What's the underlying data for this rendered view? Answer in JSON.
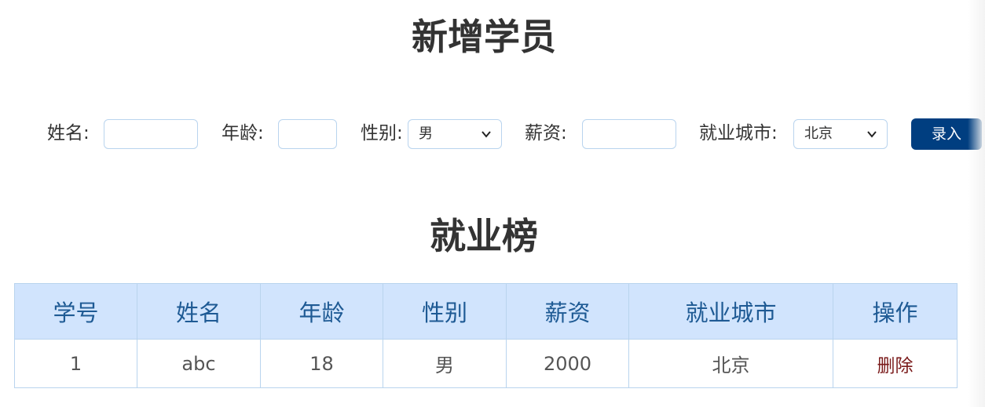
{
  "form": {
    "title": "新增学员",
    "name_label": "姓名:",
    "name_value": "",
    "age_label": "年龄:",
    "age_value": "",
    "gender_label": "性别:",
    "gender_selected": "男",
    "salary_label": "薪资:",
    "salary_value": "",
    "city_label": "就业城市:",
    "city_selected": "北京",
    "submit_label": "录入"
  },
  "board": {
    "title": "就业榜",
    "columns": [
      "学号",
      "姓名",
      "年龄",
      "性别",
      "薪资",
      "就业城市",
      "操作"
    ],
    "rows": [
      {
        "id": "1",
        "name": "abc",
        "age": "18",
        "gender": "男",
        "salary": "2000",
        "city": "北京",
        "action": "删除"
      }
    ]
  },
  "colors": {
    "header_bg": "#d1e4fd",
    "header_text": "#1e5a94",
    "button_bg": "#003e80",
    "border": "#b9d4ee",
    "delete_text": "#7a1a1a"
  },
  "icons": {
    "dropdown": "chevron-down-icon"
  }
}
